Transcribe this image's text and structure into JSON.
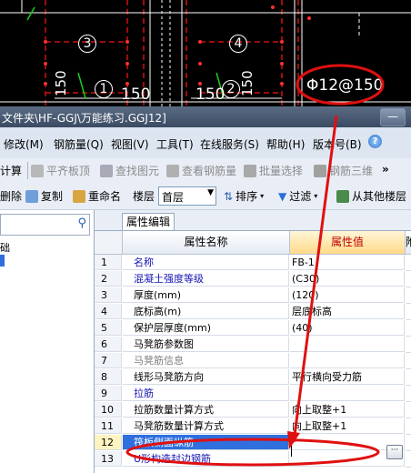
{
  "cad": {
    "numbers": {
      "n3": "3",
      "n4": "4",
      "n1": "1",
      "n2": "2"
    },
    "dims": {
      "d150a": "150",
      "d150b": "150",
      "v150a": "150",
      "v150b": "150"
    },
    "rebar_label": "Φ12@150"
  },
  "window": {
    "title": "文件夹\\HF-GGJ\\万能练习.GGJ12]",
    "btn_min": "—"
  },
  "menu": {
    "modify": "修改(M)",
    "rebar_qty": "钢筋量(Q)",
    "view": "视图(V)",
    "tools": "工具(T)",
    "online": "在线服务(S)",
    "help": "帮助(H)",
    "version": "版本号(B)"
  },
  "toolbar1": {
    "calc": "计算",
    "flush_top": "平齐板顶",
    "find_elem": "查找图元",
    "view_rebar": "查看钢筋量",
    "batch_select": "批量选择",
    "rebar_3d": "钢筋三维",
    "more": "»"
  },
  "toolbar2": {
    "delete": "删除",
    "copy": "复制",
    "rename": "重命名",
    "floor_label": "楼层",
    "floor_value": "首层",
    "sort": "排序",
    "filter": "过滤",
    "from_other": "从其他楼层"
  },
  "left": {
    "tree_item": "础"
  },
  "props": {
    "tab": "属性编辑",
    "col_name": "属性名称",
    "col_value": "属性值",
    "col_extra": "附",
    "rows": [
      {
        "num": "1",
        "name": "名称",
        "value": "FB-1"
      },
      {
        "num": "2",
        "name": "混凝土强度等级",
        "value": "(C30)"
      },
      {
        "num": "3",
        "name": "厚度(mm)",
        "value": "(120)"
      },
      {
        "num": "4",
        "name": "底标高(m)",
        "value": "层底标高"
      },
      {
        "num": "5",
        "name": "保护层厚度(mm)",
        "value": "(40)"
      },
      {
        "num": "6",
        "name": "马凳筋参数图",
        "value": ""
      },
      {
        "num": "7",
        "name": "马凳筋信息",
        "value": ""
      },
      {
        "num": "8",
        "name": "线形马凳筋方向",
        "value": "平行横向受力筋"
      },
      {
        "num": "9",
        "name": "拉筋",
        "value": ""
      },
      {
        "num": "10",
        "name": "拉筋数量计算方式",
        "value": "向上取整+1"
      },
      {
        "num": "11",
        "name": "马凳筋数量计算方式",
        "value": "向上取整+1"
      },
      {
        "num": "12",
        "name": "筏板侧面纵筋",
        "value": ""
      },
      {
        "num": "13",
        "name": "U形构造封边钢筋",
        "value": ""
      }
    ],
    "ellipsis": "···"
  },
  "colors": {
    "selected_row": "#2f6fde",
    "annotation": "#e01010",
    "blue_name": "#1414b4"
  }
}
